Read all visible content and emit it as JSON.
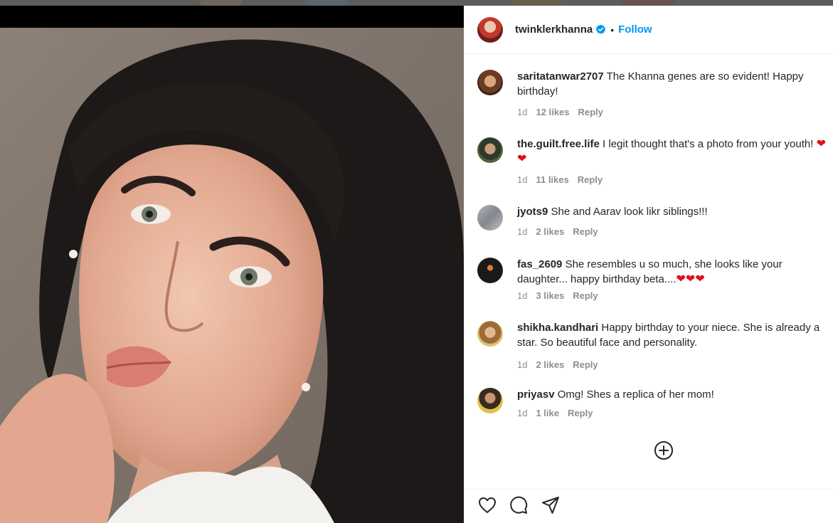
{
  "post": {
    "owner": "twinklerkhanna",
    "separator": "•",
    "follow_label": "Follow"
  },
  "comments": [
    {
      "user": "saritatanwar2707",
      "text": " The Khanna genes are so evident! Happy birthday!",
      "emoji": "",
      "age": "1d",
      "likes": "12 likes",
      "reply": "Reply"
    },
    {
      "user": "the.guilt.free.life",
      "text": " I legit thought that's a photo from your youth! ",
      "emoji": "❤❤",
      "age": "1d",
      "likes": "11 likes",
      "reply": "Reply"
    },
    {
      "user": "jyots9",
      "text": " She and Aarav look likr siblings!!!",
      "emoji": "",
      "age": "1d",
      "likes": "2 likes",
      "reply": "Reply"
    },
    {
      "user": "fas_2609",
      "text": " She resembles u so much, she looks like your daughter... happy birthday beta....",
      "emoji": "❤❤❤",
      "age": "1d",
      "likes": "3 likes",
      "reply": "Reply"
    },
    {
      "user": "shikha.kandhari",
      "text": " Happy birthday to your niece. She is already a star. So beautiful face and personality.",
      "emoji": "",
      "age": "1d",
      "likes": "2 likes",
      "reply": "Reply"
    },
    {
      "user": "priyasv",
      "text": " Omg! Shes a replica of her mom!",
      "emoji": "",
      "age": "1d",
      "likes": "1 like",
      "reply": "Reply"
    }
  ],
  "icons": {
    "verified": "verified-badge-icon",
    "load_more": "plus-circle-icon",
    "like": "heart-icon",
    "comment": "comment-bubble-icon",
    "share": "paper-plane-icon"
  },
  "colors": {
    "accent": "#0095f6",
    "heart_emoji": "#e0111a",
    "meta_text": "#8e8e8e"
  }
}
